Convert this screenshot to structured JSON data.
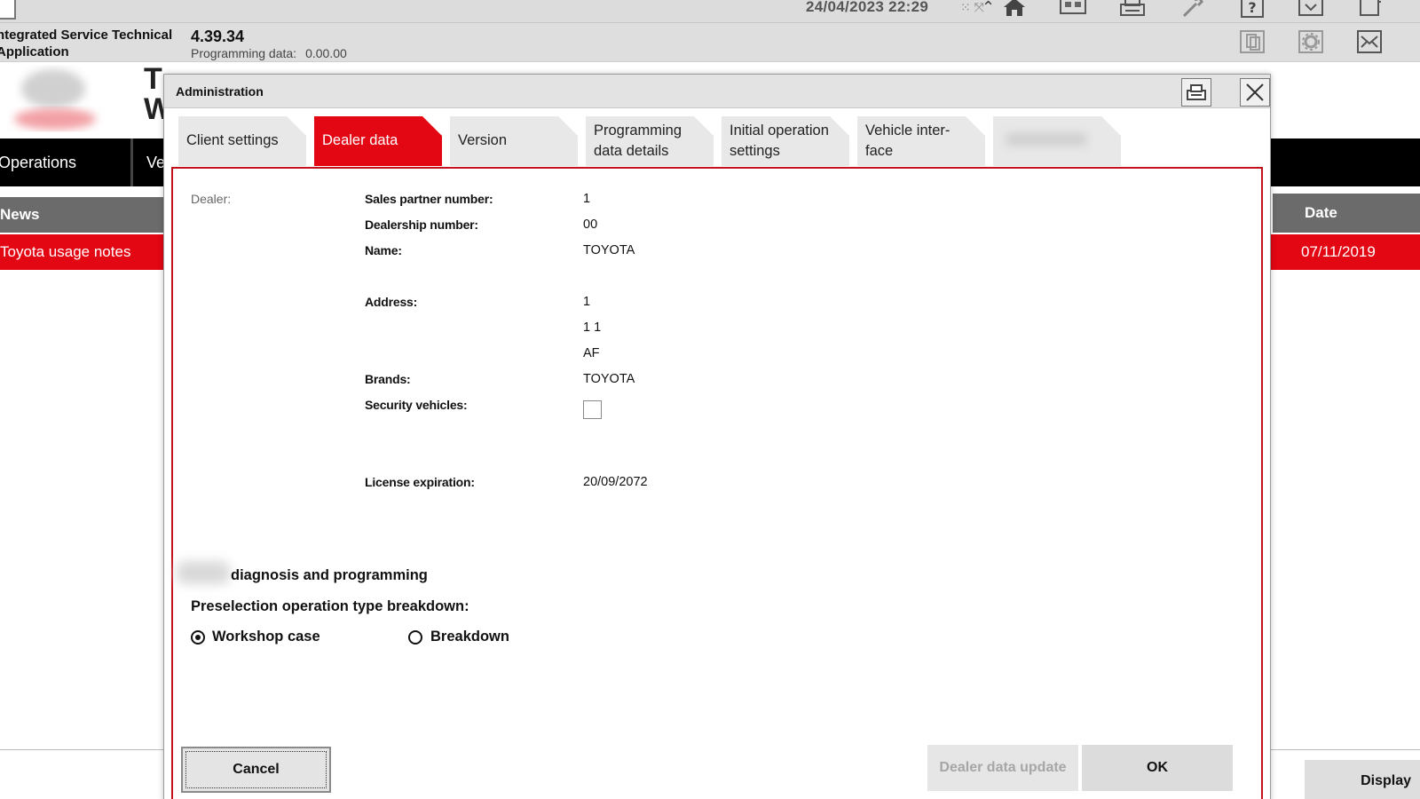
{
  "topbar": {
    "datetime": "24/04/2023 22:29",
    "icons": [
      "home-icon",
      "dual-monitor-icon",
      "printer-icon",
      "wrench-icon",
      "help-icon",
      "download-icon",
      "copy-icon"
    ]
  },
  "infobar": {
    "app_title_line1": "ntegrated Service Technical",
    "app_title_line2": "Application",
    "version": "4.39.34",
    "programming_label": "Programming data:",
    "programming_value": "0.00.00",
    "icons": [
      "documents-icon",
      "gear-icon",
      "mail-icon"
    ]
  },
  "background": {
    "brand_title_line1": "T",
    "brand_title_line2": "W",
    "nav_operations": "Operations",
    "nav_second": "Ve",
    "news_header": "News",
    "news_row": "Toyota usage notes",
    "date_header": "Date",
    "date_row": "07/11/2019",
    "display_button": "Display"
  },
  "dialog": {
    "title": "Administration",
    "tabs": [
      {
        "label": "Client settings",
        "active": false
      },
      {
        "label": "Dealer data",
        "active": true
      },
      {
        "label": "Version",
        "active": false
      },
      {
        "label": "Programming\ndata details",
        "active": false
      },
      {
        "label": "Initial operation\nsettings",
        "active": false
      },
      {
        "label": "Vehicle inter-\nface",
        "active": false
      },
      {
        "label": "",
        "active": false
      }
    ],
    "dealer": {
      "section_label": "Dealer:",
      "sales_partner_label": "Sales partner number:",
      "sales_partner_value": "1",
      "dealership_label": "Dealership number:",
      "dealership_value": "00",
      "name_label": "Name:",
      "name_value": "TOYOTA",
      "address_label": "Address:",
      "address_lines": [
        "1",
        "1 1",
        "AF"
      ],
      "brands_label": "Brands:",
      "brands_value": "TOYOTA",
      "security_label": "Security vehicles:",
      "security_checked": false,
      "license_label": "License expiration:",
      "license_value": "20/09/2072"
    },
    "diagnosis": {
      "section_title": "diagnosis and programming",
      "preselection_label": "Preselection operation type breakdown:",
      "options": [
        {
          "label": "Workshop case",
          "selected": true
        },
        {
          "label": "Breakdown",
          "selected": false
        }
      ]
    },
    "buttons": {
      "cancel": "Cancel",
      "dealer_update": "Dealer data update",
      "ok": "OK"
    }
  },
  "colors": {
    "accent_red": "#e30613",
    "panel_border": "#c2121d",
    "header_gray": "#6b6b6b"
  }
}
